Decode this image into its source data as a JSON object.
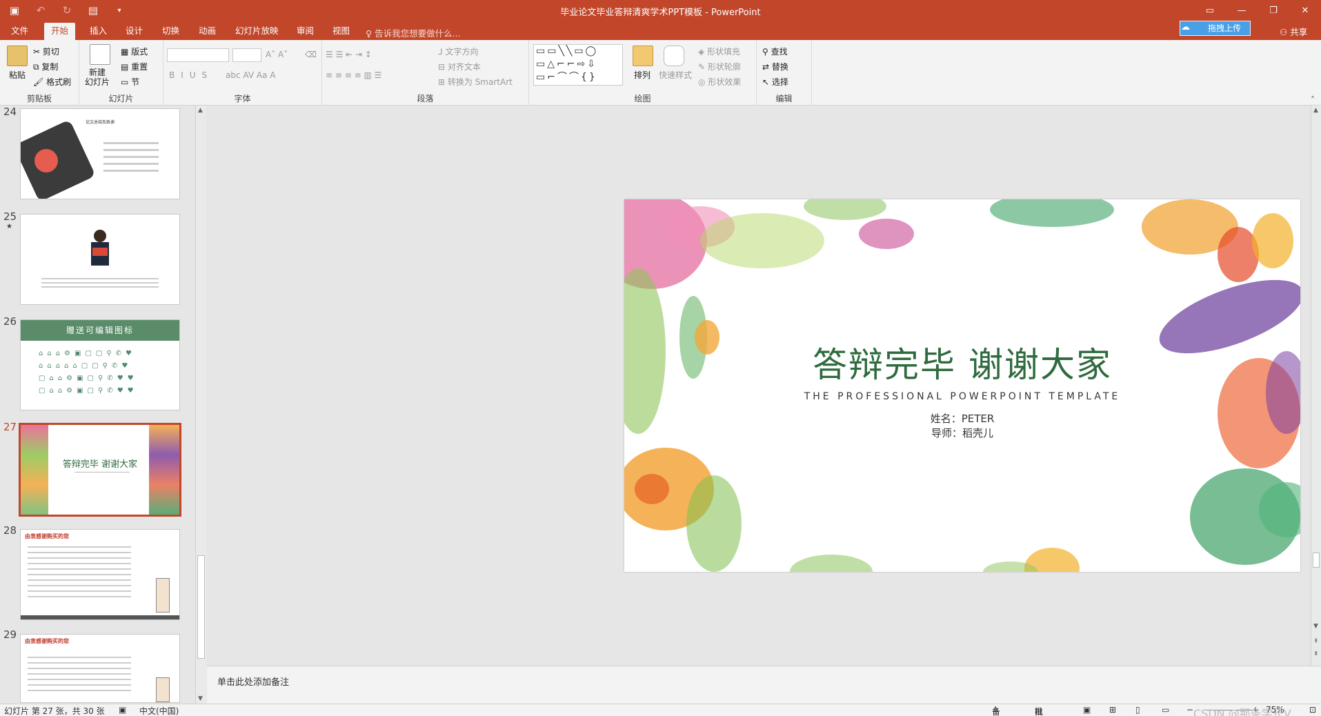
{
  "app": {
    "title": "毕业论文毕业答辩清爽学术PPT模板 - PowerPoint",
    "colors": {
      "accent": "#c1462a",
      "slide_title": "#2e6b3e"
    }
  },
  "quick_access": {
    "icons": [
      "save-icon",
      "undo-icon",
      "redo-icon",
      "present-icon",
      "customize-icon"
    ]
  },
  "tabs": [
    "文件",
    "开始",
    "插入",
    "设计",
    "切换",
    "动画",
    "幻灯片放映",
    "审阅",
    "视图"
  ],
  "active_tab": "开始",
  "tell_me": "告诉我您想要做什么...",
  "upload_label": "拖拽上传",
  "share_label": "共享",
  "ribbon": {
    "clipboard": {
      "label": "剪贴板",
      "paste": "粘贴",
      "cut": "剪切",
      "copy": "复制",
      "format_painter": "格式刷"
    },
    "slides": {
      "label": "幻灯片",
      "new_slide": "新建\n幻灯片",
      "layout": "版式",
      "reset": "重置",
      "section": "节"
    },
    "font": {
      "label": "字体"
    },
    "paragraph": {
      "label": "段落",
      "text_direction": "文字方向",
      "align_text": "对齐文本",
      "smartart": "转换为 SmartArt"
    },
    "drawing": {
      "label": "绘图",
      "arrange": "排列",
      "quick_styles": "快速样式",
      "shape_fill": "形状填充",
      "shape_outline": "形状轮廓",
      "shape_effects": "形状效果"
    },
    "editing": {
      "label": "编辑",
      "find": "查找",
      "replace": "替换",
      "select": "选择"
    }
  },
  "slides": [
    {
      "num": "24",
      "title": "论文总结及致谢"
    },
    {
      "num": "25",
      "star": "★"
    },
    {
      "num": "26",
      "title": "赠送可编辑图标"
    },
    {
      "num": "27",
      "title": "答辩完毕  谢谢大家",
      "selected": true
    },
    {
      "num": "28",
      "title": "由衷感谢购买的您"
    },
    {
      "num": "29",
      "title": "由衷感谢购买的您"
    }
  ],
  "current_slide": {
    "title": "答辩完毕  谢谢大家",
    "subtitle": "THE PROFESSIONAL POWERPOINT TEMPLATE",
    "name": "姓名：PETER",
    "teacher": "导师：稻壳儿"
  },
  "notes_placeholder": "单击此处添加备注",
  "status": {
    "slide_info": "幻灯片 第 27 张，共 30 张",
    "language": "中文(中国)",
    "notes": "备注",
    "comments": "批注",
    "zoom": "75%",
    "watermark": "CSDN @那条学长V"
  }
}
